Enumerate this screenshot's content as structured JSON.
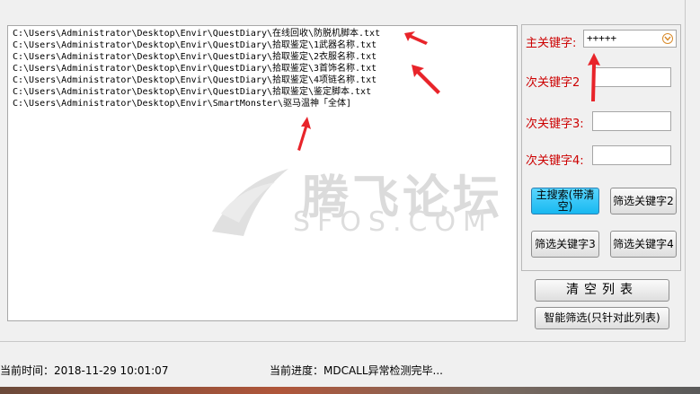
{
  "results": {
    "lines": [
      "C:\\Users\\Administrator\\Desktop\\Envir\\QuestDiary\\在线回收\\防脱机脚本.txt",
      "C:\\Users\\Administrator\\Desktop\\Envir\\QuestDiary\\拾取鉴定\\1武器名称.txt",
      "C:\\Users\\Administrator\\Desktop\\Envir\\QuestDiary\\拾取鉴定\\2衣服名称.txt",
      "C:\\Users\\Administrator\\Desktop\\Envir\\QuestDiary\\拾取鉴定\\3首饰名称.txt",
      "C:\\Users\\Administrator\\Desktop\\Envir\\QuestDiary\\拾取鉴定\\4项链名称.txt",
      "C:\\Users\\Administrator\\Desktop\\Envir\\QuestDiary\\拾取鉴定\\鉴定脚本.txt",
      "C:\\Users\\Administrator\\Desktop\\Envir\\SmartMonster\\驱马温神「全体]"
    ]
  },
  "keywords": {
    "main_label": "主关键字:",
    "main_value": "+++++",
    "k2_label": "次关键字2",
    "k2_value": "",
    "k3_label": "次关键字3:",
    "k3_value": "",
    "k4_label": "次关键字4:",
    "k4_value": ""
  },
  "buttons": {
    "main_search": "主搜索(带清空)",
    "filter2": "筛选关键字2",
    "filter3": "筛选关键字3",
    "filter4": "筛选关键字4",
    "clear_list": "清空列表",
    "smart_filter": "智能筛选(只针对此列表)"
  },
  "status": {
    "time_label": "当前时间：2018-11-29 10:01:07",
    "progress_label": "当前进度：MDCALL异常检测完毕..."
  },
  "watermark": {
    "cn": "腾飞论坛",
    "en": "SFOS.COM"
  },
  "colors": {
    "label_red": "#cc0000",
    "primary_button": "#18b8f0",
    "arrow_red": "#e8242a"
  }
}
